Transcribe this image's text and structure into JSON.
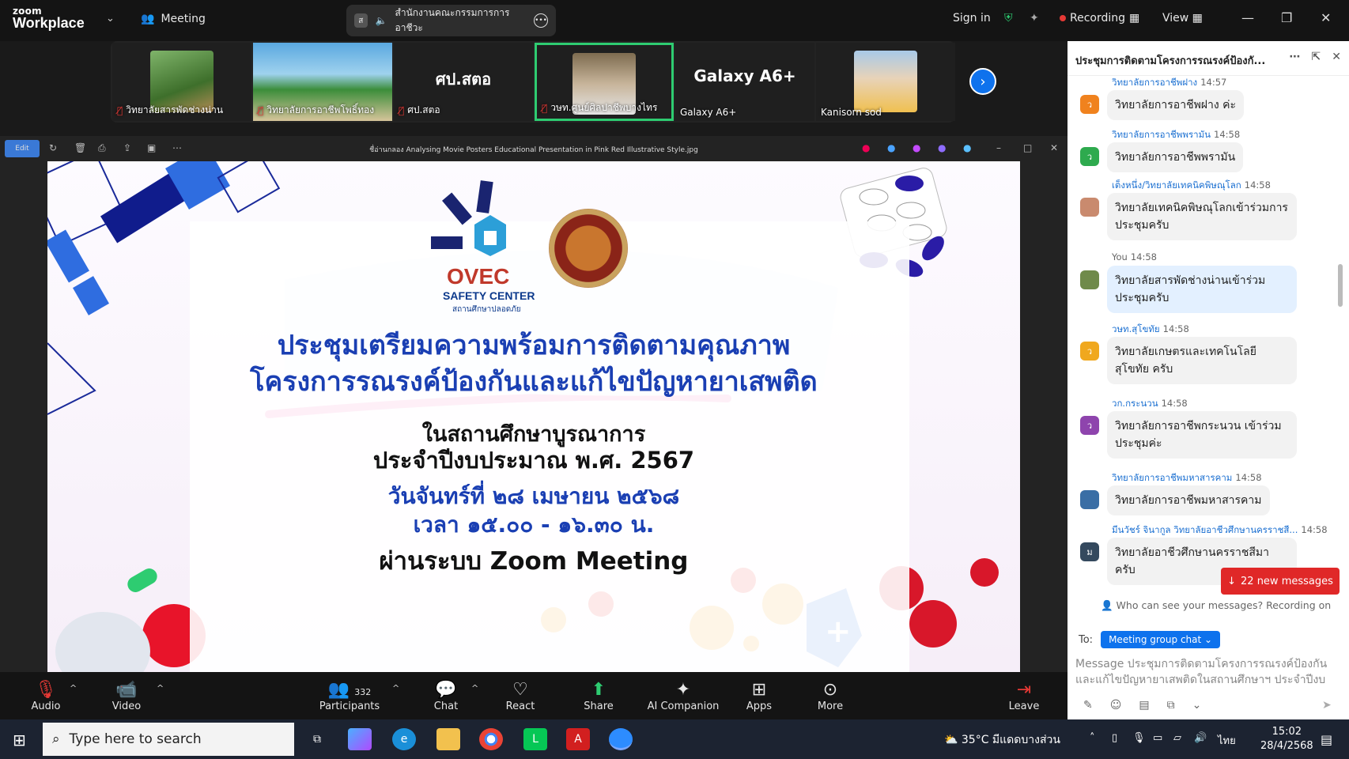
{
  "app": {
    "logo_top": "zoom",
    "logo_bottom": "Workplace",
    "meeting_label": "Meeting",
    "share_pill_text": "สำนักงานคณะกรรมการการอาชีวะ",
    "share_pill_initial": "ส",
    "sign_in": "Sign in",
    "recording": "Recording",
    "view": "View"
  },
  "thumbnails": [
    {
      "name": "วิทยาลัยสารพัดช่างน่าน",
      "muted": true,
      "kind": "photo"
    },
    {
      "name": "วิทยาลัยการอาชีพโพธิ์ทอง",
      "muted": true,
      "kind": "beach"
    },
    {
      "name": "ศป.สตอ",
      "muted": true,
      "kind": "text",
      "big": "ศป.สตอ"
    },
    {
      "name": "วษท.ศูนย์ศิลปาชีพบางไทร",
      "muted": true,
      "kind": "photo",
      "active": true
    },
    {
      "name": "Galaxy A6+",
      "muted": false,
      "kind": "text",
      "big": "Galaxy A6+"
    },
    {
      "name": "Kanisorn sod",
      "muted": false,
      "kind": "photo"
    }
  ],
  "viewer": {
    "edit_label": "Edit",
    "filename": "ชื่อ่านกลอง Analysing Movie Posters Educational Presentation in Pink Red Illustrative Style.jpg"
  },
  "slide": {
    "logo_name": "OVEC",
    "logo_sub": "SAFETY CENTER",
    "logo_sub2": "สถานศึกษาปลอดภัย",
    "title1": "ประชุมเตรียมความพร้อมการติดตามคุณภาพ",
    "title2": "โครงการรณรงค์ป้องกันและแก้ไขปัญหายาเสพติด",
    "line3": "ในสถานศึกษาบูรณาการ",
    "line4": "ประจำปีงบประมาณ พ.ศ. 2567",
    "date": "วันจันทร์ที่ ๒๘ เมษายน ๒๕๖๘",
    "time": "เวลา ๑๕.๐๐ - ๑๖.๓๐ น.",
    "via": "ผ่านระบบ Zoom Meeting"
  },
  "toolbar": {
    "audio": "Audio",
    "video": "Video",
    "participants": "Participants",
    "participants_count": "332",
    "chat": "Chat",
    "react": "React",
    "share": "Share",
    "ai": "AI Companion",
    "apps": "Apps",
    "more": "More",
    "leave": "Leave"
  },
  "chat": {
    "title": "ประชุมการติดตามโครงการรณรงค์ป้องกั...",
    "messages": [
      {
        "sender": "วิทยาลัยการอาชีพฝาง",
        "time": "14:57",
        "text": "วิทยาลัยการอาชีพฝาง ค่ะ",
        "avatar": "ว",
        "color": "#f0821e"
      },
      {
        "sender": "วิทยาลัยการอาชีพพรามัน",
        "time": "14:58",
        "text": "วิทยาลัยการอาชีพพรามัน",
        "avatar": "ว",
        "color": "#2eaa4e"
      },
      {
        "sender": "เต็งหนึ่ง/วิทยาลัยเทคนิคพิษณุโลก",
        "time": "14:58",
        "text": "วิทยาลัยเทคนิคพิษณุโลกเข้าร่วมการประชุมครับ",
        "avatar": "",
        "color": "#c98a6e"
      },
      {
        "sender": "You",
        "time": "14:58",
        "text": "วิทยาลัยสารพัดช่างน่านเข้าร่วมประชุมครับ",
        "avatar": "",
        "color": "#6f8a4a",
        "me": true
      },
      {
        "sender": "วษท.สุโขทัย",
        "time": "14:58",
        "text": "วิทยาลัยเกษตรและเทคโนโลยีสุโขทัย ครับ",
        "avatar": "ว",
        "color": "#f0a81e"
      },
      {
        "sender": "วก.กระนวน",
        "time": "14:58",
        "text": "วิทยาลัยการอาชีพกระนวน เข้าร่วมประชุมค่ะ",
        "avatar": "ว",
        "color": "#8e44ad"
      },
      {
        "sender": "วิทยาลัยการอาชีพมหาสารคาม",
        "time": "14:58",
        "text": "วิทยาลัยการอาชีพมหาสารคาม",
        "avatar": "",
        "color": "#3a6ea5"
      },
      {
        "sender": "มีนวัชร์ จินากูล วิทยาลัยอาชีวศึกษานครราชสี...",
        "time": "14:58",
        "text": "วิทยาลัยอาชีวศึกษานครราชสีมาครับ",
        "avatar": "ม",
        "color": "#34495e"
      }
    ],
    "new_messages": "22 new messages",
    "who_can_see": "Who can see your messages? Recording on",
    "to_label": "To:",
    "to_target": "Meeting group chat",
    "input_placeholder": "Message ประชุมการติดตามโครงการรณรงค์ป้องกันและแก้ไขปัญหายาเสพติดในสถานศึกษาฯ ประจำปีงบ"
  },
  "taskbar": {
    "search_placeholder": "Type here to search",
    "weather": "35°C  มีแดดบางส่วน",
    "lang": "ไทย",
    "time": "15:02",
    "date": "28/4/2568"
  }
}
